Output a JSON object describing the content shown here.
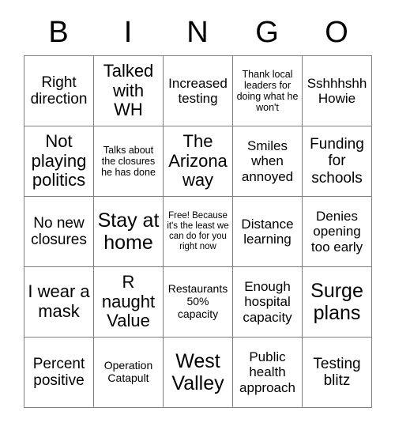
{
  "header": {
    "letters": [
      "B",
      "I",
      "N",
      "G",
      "O"
    ]
  },
  "grid": {
    "columns": 5,
    "rows": 5,
    "border_color": "#808080",
    "background_color": "#ffffff",
    "text_color": "#000000",
    "cells": [
      {
        "text": "Right direction",
        "size": "lg"
      },
      {
        "text": "Talked with WH",
        "size": "xl"
      },
      {
        "text": "Increased testing",
        "size": "md"
      },
      {
        "text": "Thank local leaders for doing what he won't",
        "size": "xs"
      },
      {
        "text": "Sshhhshh Howie",
        "size": "md"
      },
      {
        "text": "Not playing politics",
        "size": "xl"
      },
      {
        "text": "Talks about the closures he has done",
        "size": "xs"
      },
      {
        "text": "The Arizona way",
        "size": "xl"
      },
      {
        "text": "Smiles when annoyed",
        "size": "md"
      },
      {
        "text": "Funding for schools",
        "size": "lg"
      },
      {
        "text": "No new closures",
        "size": "lg"
      },
      {
        "text": "Stay at home",
        "size": "xxl"
      },
      {
        "text": "Free! Because it's the least we can do for you right now",
        "size": "xxs"
      },
      {
        "text": "Distance learning",
        "size": "md"
      },
      {
        "text": "Denies opening too early",
        "size": "md"
      },
      {
        "text": "I wear a mask",
        "size": "xl"
      },
      {
        "text": "R naught Value",
        "size": "xl"
      },
      {
        "text": "Restaurants 50% capacity",
        "size": "sm"
      },
      {
        "text": "Enough hospital capacity",
        "size": "md"
      },
      {
        "text": "Surge plans",
        "size": "xxl"
      },
      {
        "text": "Percent positive",
        "size": "lg"
      },
      {
        "text": "Operation Catapult",
        "size": "sm"
      },
      {
        "text": "West Valley",
        "size": "xxl"
      },
      {
        "text": "Public health approach",
        "size": "md"
      },
      {
        "text": "Testing blitz",
        "size": "lg"
      }
    ]
  }
}
